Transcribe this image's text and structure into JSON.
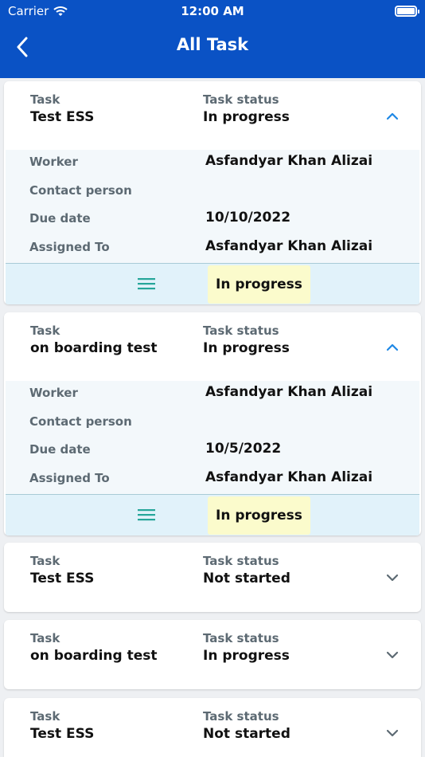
{
  "status_bar": {
    "carrier": "Carrier",
    "time": "12:00 AM"
  },
  "nav": {
    "title": "All Task"
  },
  "labels": {
    "task": "Task",
    "task_status": "Task status",
    "worker": "Worker",
    "contact_person": "Contact person",
    "due_date": "Due date",
    "assigned_to": "Assigned To"
  },
  "tasks": [
    {
      "name": "Test ESS",
      "status": "In progress",
      "expanded": true,
      "worker": "Asfandyar Khan Alizai",
      "contact_person": "",
      "due_date": "10/10/2022",
      "assigned_to": "Asfandyar Khan Alizai",
      "status_pill": "In progress"
    },
    {
      "name": "on boarding test",
      "status": "In progress",
      "expanded": true,
      "worker": "Asfandyar Khan Alizai",
      "contact_person": "",
      "due_date": "10/5/2022",
      "assigned_to": "Asfandyar Khan Alizai",
      "status_pill": "In progress"
    },
    {
      "name": "Test ESS",
      "status": "Not started",
      "expanded": false
    },
    {
      "name": "on boarding test",
      "status": "In progress",
      "expanded": false
    },
    {
      "name": "Test ESS",
      "status": "Not started",
      "expanded": false
    }
  ],
  "colors": {
    "brand": "#0a52c5",
    "chevron_expanded": "#1e88e5",
    "chevron_collapsed": "#5d6a73",
    "menu_icon": "#26a69a",
    "pill_bg": "#fbfbcc"
  },
  "icons": {
    "back": "chevron-left-icon",
    "wifi": "wifi-icon",
    "battery": "battery-icon",
    "expand": "chevron-up-icon",
    "collapse": "chevron-down-icon",
    "menu": "menu-icon"
  }
}
